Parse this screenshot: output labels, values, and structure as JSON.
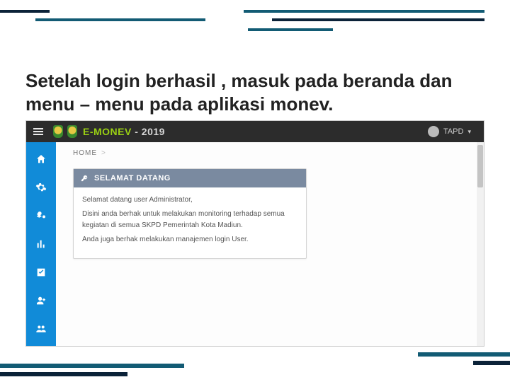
{
  "caption": "Setelah login berhasil , masuk pada beranda dan menu – menu pada aplikasi monev.",
  "app": {
    "name_main": "E-MONEV",
    "name_year": " - 2019",
    "user": "TAPD"
  },
  "sidebar": {
    "items": [
      {
        "name": "nav-home"
      },
      {
        "name": "nav-settings"
      },
      {
        "name": "nav-advanced-settings"
      },
      {
        "name": "nav-stats"
      },
      {
        "name": "nav-check"
      },
      {
        "name": "nav-user-add"
      },
      {
        "name": "nav-users"
      }
    ]
  },
  "breadcrumb": {
    "item": "HOME",
    "sep": ">"
  },
  "panel": {
    "title": "SELAMAT DATANG",
    "line1": "Selamat datang user Administrator,",
    "line2": "Disini anda berhak untuk melakukan monitoring terhadap semua kegiatan di semua SKPD Pemerintah Kota Madiun.",
    "line3": "Anda juga berhak melakukan manajemen login User."
  }
}
